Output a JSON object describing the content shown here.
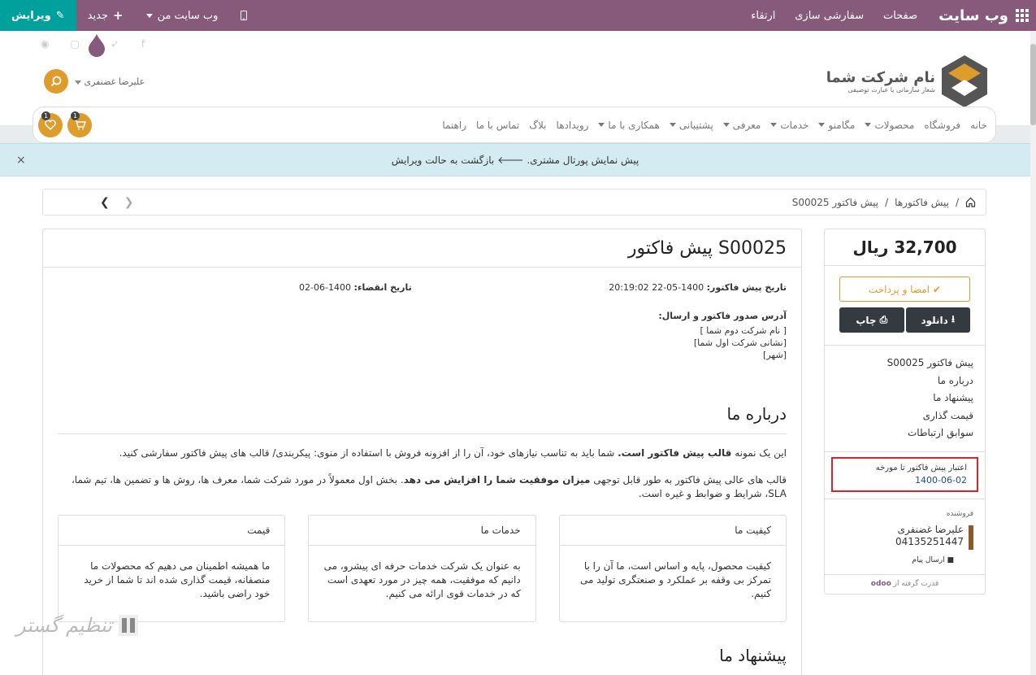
{
  "topbar": {
    "brand": "وب سایت",
    "menu": [
      "صفحات",
      "سفارشی سازی",
      "ارتقاء"
    ],
    "mysite": "وب سایت من",
    "new": "جدید",
    "edit": "ویرایش"
  },
  "header": {
    "logo_title": "نام شرکت شما",
    "logo_sub": "شعار سازمانی یا عبارت توصیفی",
    "user": "علیرضا غضنفری"
  },
  "nav": {
    "items": [
      "خانه",
      "فروشگاه",
      "محصولات",
      "مگامنو",
      "خدمات",
      "معرفی",
      "پشتیبانی",
      "همکاری با ما",
      "رویدادها",
      "بلاگ",
      "تماس با ما",
      "راهنما"
    ],
    "cart_count": "1",
    "wish_count": "1"
  },
  "alert": {
    "text_a": "پیش نمایش پورتال مشتری.",
    "text_b": "بازگشت به حالت ویرایش"
  },
  "breadcrumb": {
    "root": "پیش فاکتورها",
    "current": "پیش فاکتور S00025"
  },
  "doc": {
    "title": "پیش فاکتور S00025",
    "quote_date_label": "تاریخ پیش فاکتور:",
    "quote_date": "1400-05-22 20:19:02",
    "expire_label": "تاریخ انقضاء:",
    "expire_date": "1400-06-02",
    "addr_label": "آدرس صدور فاکتور و ارسال:",
    "addr_lines": [
      "[ نام شرکت دوم شما ]",
      "[نشانی شرکت اول شما]",
      "[شهر]"
    ],
    "about_title": "درباره ما",
    "p1_a": "این یک نمونه ",
    "p1_b": "قالب پیش فاکتور است.",
    "p1_c": " شما باید به تناسب نیازهای خود، آن را از افزونه فروش با استفاده از منوی: پیکربندی/ قالب های پیش فاکتور سفارشی کنید.",
    "p2_a": "قالب های عالی پیش فاکتور به طور قابل توجهی ",
    "p2_b": "میزان موفقیت شما را افزایش می دهد",
    "p2_c": ". بخش اول معمولاً در مورد شرکت شما، معرف ها، روش ها و تضمین ها، تیم شما، SLA، شرایط و ضوابط و غیره است.",
    "cards": [
      {
        "title": "کیفیت ما",
        "body": "کیفیت محصول، پایه و اساس است، ما آن را با تمرکز بی وقفه بر عملکرد و صنعتگری تولید می کنیم."
      },
      {
        "title": "خدمات ما",
        "body": "به عنوان یک شرکت خدمات حرفه ای پیشرو، می دانیم که موفقیت، همه چیز در مورد تعهدی است که در خدمات قوی ارائه می کنیم."
      },
      {
        "title": "قیمت",
        "body": "ما همیشه اطمینان می دهیم که محصولات ما منصفانه، قیمت گذاری شده اند تا شما از خرید خود راضی باشید."
      }
    ],
    "offer_title": "پیشنهاد ما"
  },
  "sidebar": {
    "amount": "32,700 ریال",
    "pay": "امضا و پرداخت",
    "download": "دانلود",
    "print": "چاپ",
    "links": [
      "پیش فاکتور S00025",
      "درباره ما",
      "پیشنهاد ما",
      "قیمت گذاری",
      "سوابق ارتباطات"
    ],
    "valid_label": "اعتبار پیش فاکتور تا مورخه",
    "valid_date": "1400-06-02",
    "seller_label": "فروشنده",
    "seller_name": "علیرضا غضنفری",
    "seller_phone": "04135251447",
    "send_msg": "ارسال پیام",
    "powered": "قدرت گرفته از",
    "odoo": "odoo"
  },
  "watermark": "تنظیم گستر",
  "colors": {
    "topbar": "#875a7b",
    "edit": "#00a09d",
    "accent": "#dd9c2b",
    "highlight_border": "#d9232e"
  }
}
